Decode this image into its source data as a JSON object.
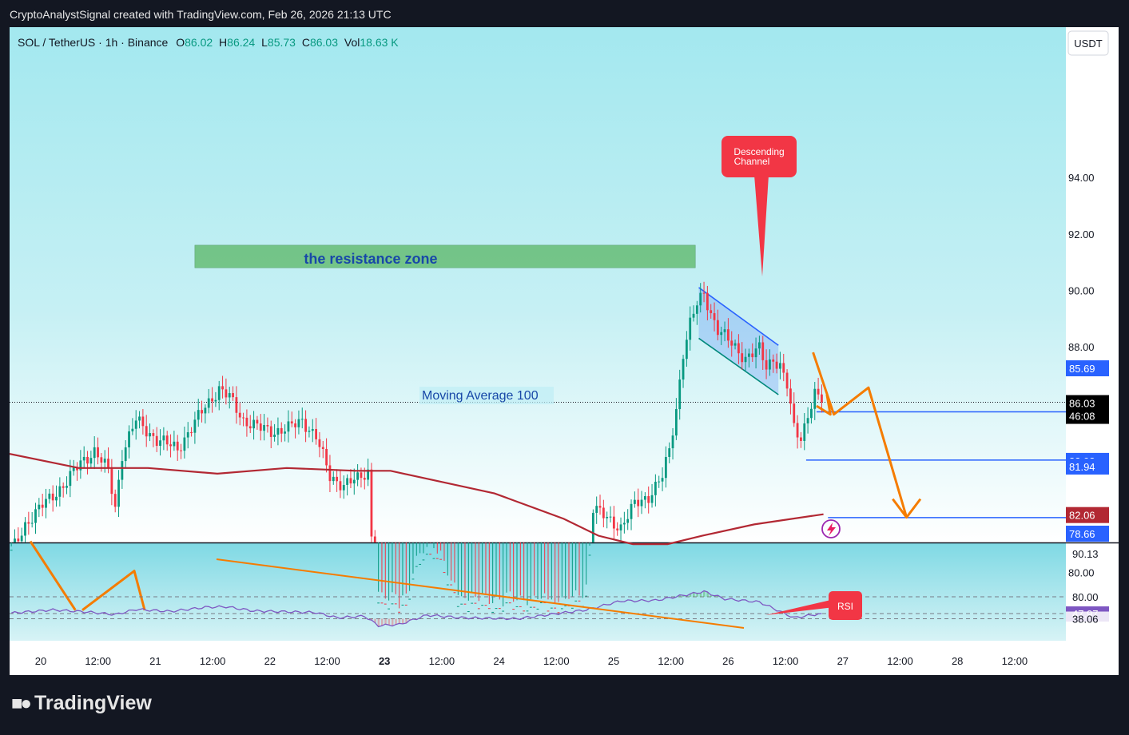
{
  "header": {
    "text": "CryptoAnalystSignal created with TradingView.com, Feb 26, 2026 21:13 UTC"
  },
  "legend": {
    "symbol": "SOL / TetherUS · 1h · Binance",
    "o_label": "O",
    "o_value": "86.02",
    "h_label": "H",
    "h_value": "86.24",
    "l_label": "L",
    "l_value": "85.73",
    "c_label": "C",
    "c_value": "86.03",
    "vol_label": "Vol",
    "vol_value": "18.63 K"
  },
  "currency_button": "USDT",
  "logo": {
    "text": "TradingView",
    "icon": "tradingview-logo-icon"
  },
  "annotations": {
    "resistance": "the resistance zone",
    "moving_average": "Moving Average 100",
    "channel_line1": "Descending",
    "channel_line2": "Channel",
    "rsi": "RSI"
  },
  "price_tags": [
    {
      "text": "86.03",
      "sub": "46:08",
      "price": 86.03,
      "color": "#000000"
    },
    {
      "text": "85.69",
      "price": 85.69,
      "color": "#2962ff"
    },
    {
      "text": "83.98",
      "price": 83.98,
      "color": "#2962ff"
    },
    {
      "text": "82.06",
      "price": 82.06,
      "color": "#b22833"
    },
    {
      "text": "81.94",
      "price": 81.94,
      "color": "#2962ff"
    },
    {
      "text": "78.66",
      "price": 78.66,
      "color": "#2962ff"
    }
  ],
  "rsi_tags": [
    {
      "text": "90.13",
      "value": 90.13,
      "style": "light"
    },
    {
      "text": "47.97",
      "value": 47.97,
      "style": "purple"
    },
    {
      "text": "38.06",
      "value": 38.06,
      "style": "light"
    }
  ],
  "colors": {
    "up": "#089981",
    "down": "#f23645",
    "ma": "#b22833",
    "rsi": "#7e57c2",
    "bg_top": "#b2ebf2",
    "bg_bottom": "#ffffff",
    "orange": "#f57c00"
  },
  "chart_data": {
    "type": "candlestick",
    "price_axis": {
      "ticks": [
        80,
        82,
        84,
        86,
        88,
        90,
        92,
        94
      ],
      "tick_labels": [
        "80.00",
        "",
        "",
        "",
        "88.00",
        "90.00",
        "92.00",
        "94.00"
      ],
      "range": [
        78.66,
        96.2
      ]
    },
    "time_axis": {
      "labels": [
        "20",
        "12:00",
        "21",
        "12:00",
        "22",
        "12:00",
        "23",
        "12:00",
        "24",
        "12:00",
        "25",
        "12:00",
        "26",
        "12:00",
        "27",
        "12:00",
        "28",
        "12:00"
      ],
      "bold": [
        "23"
      ]
    },
    "resistance_zone": [
      90.8,
      91.6
    ],
    "horizontal_levels": [
      85.69,
      83.98,
      81.94
    ],
    "last_price": 86.03,
    "series": [
      {
        "t": 0,
        "c": 80.7
      },
      {
        "t": 4,
        "c": 81.7
      },
      {
        "t": 10,
        "c": 82.5
      },
      {
        "t": 16,
        "c": 83.2
      },
      {
        "t": 20,
        "c": 83.9
      },
      {
        "t": 24,
        "c": 84.3
      },
      {
        "t": 28,
        "c": 83.6
      },
      {
        "t": 30,
        "c": 82.3
      },
      {
        "t": 32,
        "c": 84.2
      },
      {
        "t": 36,
        "c": 85.4
      },
      {
        "t": 42,
        "c": 84.7
      },
      {
        "t": 48,
        "c": 84.4
      },
      {
        "t": 52,
        "c": 85.1
      },
      {
        "t": 56,
        "c": 85.9
      },
      {
        "t": 60,
        "c": 86.5
      },
      {
        "t": 63,
        "c": 86.2
      },
      {
        "t": 67,
        "c": 85.4
      },
      {
        "t": 72,
        "c": 85.1
      },
      {
        "t": 76,
        "c": 85.0
      },
      {
        "t": 80,
        "c": 85.1
      },
      {
        "t": 84,
        "c": 85.4
      },
      {
        "t": 88,
        "c": 84.8
      },
      {
        "t": 92,
        "c": 83.4
      },
      {
        "t": 96,
        "c": 83.1
      },
      {
        "t": 100,
        "c": 83.3
      },
      {
        "t": 103,
        "c": 83.6
      },
      {
        "t": 105,
        "c": 79.0
      },
      {
        "t": 107,
        "c": 78.66
      },
      {
        "t": 114,
        "c": 78.8
      },
      {
        "t": 118,
        "c": 80.4
      },
      {
        "t": 122,
        "c": 80.7
      },
      {
        "t": 125,
        "c": 79.6
      },
      {
        "t": 128,
        "c": 78.9
      },
      {
        "t": 134,
        "c": 78.66
      },
      {
        "t": 140,
        "c": 78.66
      },
      {
        "t": 146,
        "c": 78.66
      },
      {
        "t": 150,
        "c": 78.66
      },
      {
        "t": 162,
        "c": 78.66
      },
      {
        "t": 166,
        "c": 79.1
      },
      {
        "t": 168,
        "c": 82.3
      },
      {
        "t": 172,
        "c": 81.9
      },
      {
        "t": 176,
        "c": 81.6
      },
      {
        "t": 180,
        "c": 82.4
      },
      {
        "t": 184,
        "c": 82.7
      },
      {
        "t": 188,
        "c": 83.4
      },
      {
        "t": 190,
        "c": 84.3
      },
      {
        "t": 192,
        "c": 85.8
      },
      {
        "t": 194,
        "c": 87.8
      },
      {
        "t": 196,
        "c": 88.8
      },
      {
        "t": 198,
        "c": 89.5
      },
      {
        "t": 200,
        "c": 89.9
      },
      {
        "t": 202,
        "c": 89.2
      },
      {
        "t": 204,
        "c": 88.6
      },
      {
        "t": 208,
        "c": 88.1
      },
      {
        "t": 212,
        "c": 87.6
      },
      {
        "t": 216,
        "c": 87.9
      },
      {
        "t": 218,
        "c": 87.3
      },
      {
        "t": 220,
        "c": 87.6
      },
      {
        "t": 222,
        "c": 87.3
      },
      {
        "t": 224,
        "c": 86.6
      },
      {
        "t": 226,
        "c": 85.1
      },
      {
        "t": 228,
        "c": 84.8
      },
      {
        "t": 230,
        "c": 85.6
      },
      {
        "t": 232,
        "c": 86.3
      },
      {
        "t": 234,
        "c": 86.03
      }
    ],
    "moving_average_100": [
      {
        "t": 0,
        "v": 84.2
      },
      {
        "t": 20,
        "v": 83.7
      },
      {
        "t": 40,
        "v": 83.7
      },
      {
        "t": 60,
        "v": 83.5
      },
      {
        "t": 80,
        "v": 83.7
      },
      {
        "t": 100,
        "v": 83.6
      },
      {
        "t": 110,
        "v": 83.6
      },
      {
        "t": 125,
        "v": 83.2
      },
      {
        "t": 140,
        "v": 82.8
      },
      {
        "t": 160,
        "v": 81.9
      },
      {
        "t": 170,
        "v": 81.3
      },
      {
        "t": 180,
        "v": 81.0
      },
      {
        "t": 190,
        "v": 81.0
      },
      {
        "t": 200,
        "v": 81.3
      },
      {
        "t": 215,
        "v": 81.7
      },
      {
        "t": 235,
        "v": 82.06
      }
    ],
    "rsi": {
      "levels": [
        38.06,
        47.97,
        80.0
      ],
      "axis_labels": [
        "80.00",
        "47.97",
        "38.06"
      ],
      "values": [
        {
          "t": 0,
          "v": 49
        },
        {
          "t": 12,
          "v": 55
        },
        {
          "t": 22,
          "v": 51
        },
        {
          "t": 30,
          "v": 46
        },
        {
          "t": 36,
          "v": 56
        },
        {
          "t": 46,
          "v": 52
        },
        {
          "t": 56,
          "v": 60
        },
        {
          "t": 62,
          "v": 61
        },
        {
          "t": 70,
          "v": 53
        },
        {
          "t": 82,
          "v": 51
        },
        {
          "t": 88,
          "v": 50
        },
        {
          "t": 94,
          "v": 40
        },
        {
          "t": 102,
          "v": 43
        },
        {
          "t": 106,
          "v": 25
        },
        {
          "t": 112,
          "v": 27
        },
        {
          "t": 120,
          "v": 45
        },
        {
          "t": 130,
          "v": 40
        },
        {
          "t": 146,
          "v": 38
        },
        {
          "t": 166,
          "v": 55
        },
        {
          "t": 176,
          "v": 72
        },
        {
          "t": 186,
          "v": 73
        },
        {
          "t": 200,
          "v": 90
        },
        {
          "t": 206,
          "v": 76
        },
        {
          "t": 216,
          "v": 70
        },
        {
          "t": 226,
          "v": 40
        },
        {
          "t": 234,
          "v": 47.97
        }
      ]
    }
  }
}
